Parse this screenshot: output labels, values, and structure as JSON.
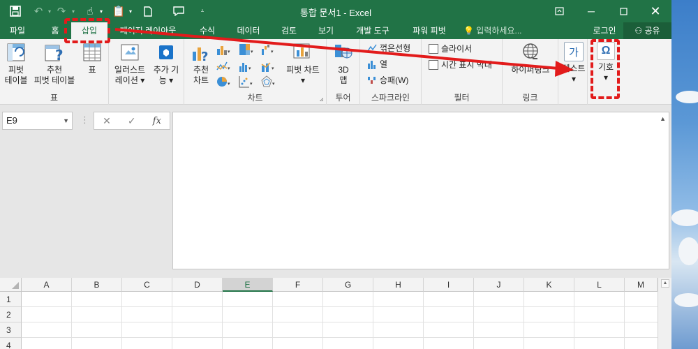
{
  "window": {
    "title": "통합 문서1 - Excel",
    "qat": {
      "save_icon": "save-icon",
      "undo_icon": "undo-icon",
      "redo_icon": "redo-icon",
      "touch_icon": "touch-mode-icon",
      "paste_icon": "paste-icon",
      "new_icon": "new-document-icon",
      "comment_icon": "comment-icon",
      "customize_icon": "customize-qat-icon"
    },
    "controls": {
      "restore_ribbon": "ribbon-display-icon",
      "minimize": "minimize-icon",
      "maximize": "maximize-icon",
      "close": "close-icon"
    }
  },
  "tabs": [
    {
      "label": "파일",
      "active": false
    },
    {
      "label": "홈",
      "active": false
    },
    {
      "label": "삽입",
      "active": true
    },
    {
      "label": "페이지 레이아웃",
      "active": false
    },
    {
      "label": "수식",
      "active": false
    },
    {
      "label": "데이터",
      "active": false
    },
    {
      "label": "검토",
      "active": false
    },
    {
      "label": "보기",
      "active": false
    },
    {
      "label": "개발 도구",
      "active": false
    },
    {
      "label": "파워 피벗",
      "active": false
    }
  ],
  "tell_me": {
    "placeholder": "입력하세요...",
    "icon": "lightbulb-icon"
  },
  "account": {
    "login": "로그인",
    "share": "공유",
    "share_icon": "person-icon"
  },
  "ribbon": {
    "tables": {
      "group_label": "표",
      "pivot_line1": "피벗",
      "pivot_line2": "테이블",
      "recommended_line1": "추천",
      "recommended_line2": "피벗 테이블",
      "table": "표"
    },
    "illustrations": {
      "label_line1": "일러스트",
      "label_line2": "레이션"
    },
    "addins": {
      "label_line1": "추가 기",
      "label_line2": "능"
    },
    "charts": {
      "group_label": "차트",
      "recommended_line1": "추천",
      "recommended_line2": "차트",
      "pivot_chart": "피벗 차트"
    },
    "tours": {
      "group_label": "투어",
      "map_line1": "3D",
      "map_line2": "맵"
    },
    "sparklines": {
      "group_label": "스파크라인",
      "line": "꺾은선형",
      "column": "열",
      "winloss": "승패(W)"
    },
    "filters": {
      "group_label": "필터",
      "slicer": "슬라이서",
      "timeline": "시간 표시 막대"
    },
    "links": {
      "group_label": "링크",
      "hyperlink": "하이퍼링크"
    },
    "text": {
      "label": "텍스트"
    },
    "symbols": {
      "label": "기호"
    }
  },
  "formula_bar": {
    "name_box": "E9",
    "cancel": "✕",
    "enter": "✓",
    "fx": "fx",
    "content": ""
  },
  "grid": {
    "columns": [
      "A",
      "B",
      "C",
      "D",
      "E",
      "F",
      "G",
      "H",
      "I",
      "J",
      "K",
      "L",
      "M"
    ],
    "selected_column": "E",
    "rows": [
      "1",
      "2",
      "3",
      "4"
    ]
  },
  "annotation": {
    "color": "#e21b1b",
    "from": "삽입",
    "to": "기호"
  },
  "colors": {
    "excel_green": "#217346",
    "ribbon_bg": "#f3f3f3"
  }
}
